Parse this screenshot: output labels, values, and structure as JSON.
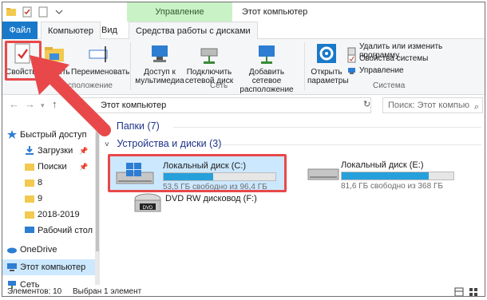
{
  "window": {
    "context_tab_group": "Управление",
    "title": "Этот компьютер"
  },
  "tabs": [
    {
      "label": "Файл"
    },
    {
      "label": "Компьютер"
    },
    {
      "label": "Вид"
    },
    {
      "label": "Средства работы с дисками"
    }
  ],
  "ribbon": {
    "properties": "Свойства",
    "open": "Открыть",
    "rename": "Переименовать",
    "group_location": "Расположение",
    "media_access_line1": "Доступ к",
    "media_access_line2": "мультимедиа",
    "map_drive_line1": "Подключить",
    "map_drive_line2": "сетевой диск",
    "add_location_line1": "Добавить сетевое",
    "add_location_line2": "расположение",
    "group_network": "Сеть",
    "open_settings_line1": "Открыть",
    "open_settings_line2": "параметры",
    "uninstall": "Удалить или изменить программу",
    "system_props": "Свойства системы",
    "manage": "Управление",
    "group_system": "Система"
  },
  "address": {
    "path": "Этот компьютер",
    "search_placeholder": "Поиск: Этот компью"
  },
  "nav": {
    "quick_access": "Быстрый доступ",
    "downloads": "Загрузки",
    "search": "Поиски",
    "f8": "8",
    "f9": "9",
    "f2018": "2018-2019",
    "desktop": "Рабочий стол",
    "onedrive": "OneDrive",
    "this_pc": "Этот компьютер",
    "network": "Сеть"
  },
  "content": {
    "folders_header": "Папки (7)",
    "devices_header": "Устройства и диски (3)",
    "drives": [
      {
        "name": "Локальный диск (C:)",
        "free_text": "53,5 ГБ свободно из 96,4 ГБ",
        "used_fraction": 0.445
      },
      {
        "name": "Локальный диск (E:)",
        "free_text": "81,6 ГБ свободно из 368 ГБ",
        "used_fraction": 0.778
      },
      {
        "name": "DVD RW дисковод (F:)"
      }
    ]
  },
  "status": {
    "items": "Элементов: 10",
    "selected": "Выбран 1 элемент"
  },
  "colors": {
    "accent": "#1979ca",
    "highlight_red": "#e8484a",
    "drive_bar": "#26a0da",
    "selection": "#cce8ff"
  }
}
